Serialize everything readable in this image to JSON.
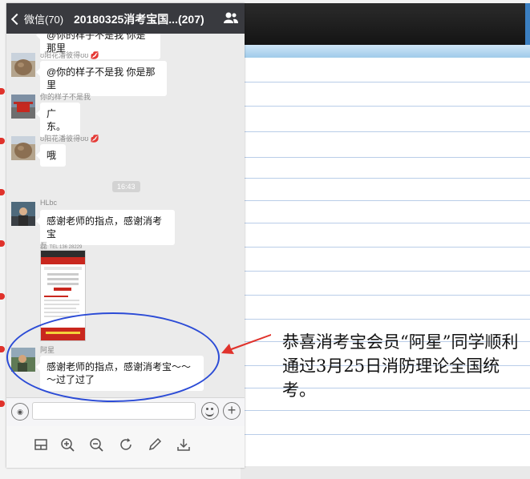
{
  "nav": {
    "back_label": "微信(70)",
    "title": "20180325消考宝国...(207)"
  },
  "messages": [
    {
      "id": "m0",
      "sender": "",
      "text": "@你的样子不是我 你是那里"
    },
    {
      "id": "m1",
      "sender": "ʊ阳花潘彼得ʊʊ",
      "text": "@你的样子不是我 你是那里"
    },
    {
      "id": "m2",
      "sender": "你的样子不是我",
      "text": "广东。"
    },
    {
      "id": "m3",
      "sender": "ʊ阳花潘彼得ʊʊ",
      "text": "哦"
    },
    {
      "id": "m4",
      "sender": "HLbc",
      "text": "感谢老师的指点，感谢消考宝"
    },
    {
      "id": "m5",
      "sender": "磊",
      "text": ""
    },
    {
      "id": "m6",
      "sender": "阿星",
      "text": "感谢老师的指点，感谢消考宝～～～过了过了"
    }
  ],
  "image_msg": {
    "sender_sub": "TEL 136 28229"
  },
  "time_stamp": "16:43",
  "annotation": {
    "caption": "恭喜消考宝会员“阿星”同学顺利通过3月25日消防理论全国统考。"
  },
  "colors": {
    "nav_bg": "#393a3f",
    "chat_bg": "#ebebeb",
    "annotation_blue": "#2b4bd6",
    "arrow_red": "#e0322b"
  },
  "icons": {
    "nav": [
      "chevron-left-icon",
      "group-people-icon"
    ],
    "input": [
      "voice-icon",
      "emoji-icon",
      "plus-icon"
    ],
    "toolbar": [
      "thumbnail-icon",
      "zoom-in-icon",
      "zoom-out-icon",
      "rotate-icon",
      "edit-pen-icon",
      "download-icon"
    ]
  }
}
